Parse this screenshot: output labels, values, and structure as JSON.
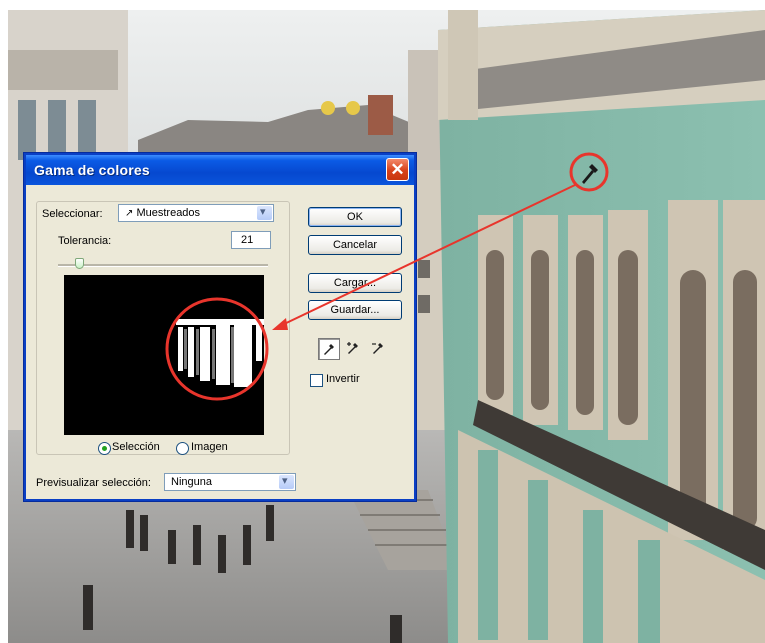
{
  "dialog": {
    "title": "Gama de colores",
    "select_label": "Seleccionar:",
    "select_value": "Muestreados",
    "tolerance_label": "Tolerancia:",
    "tolerance_value": "21",
    "tolerance_level_percent": 10,
    "view_options": [
      {
        "label": "Selección",
        "selected": true
      },
      {
        "label": "Imagen",
        "selected": false
      }
    ],
    "preview_label": "Previsualizar selección:",
    "preview_value": "Ninguna",
    "buttons": {
      "ok": "OK",
      "cancel": "Cancelar",
      "load": "Cargar...",
      "save": "Guardar..."
    },
    "invert_label": "Invertir",
    "invert_checked": false,
    "eyedroppers": [
      "eyedropper-icon",
      "eyedropper-plus-icon",
      "eyedropper-minus-icon"
    ]
  },
  "colors": {
    "title_bar": "#0648cf",
    "close_button": "#d8411a",
    "annotation": "#e8352c"
  }
}
